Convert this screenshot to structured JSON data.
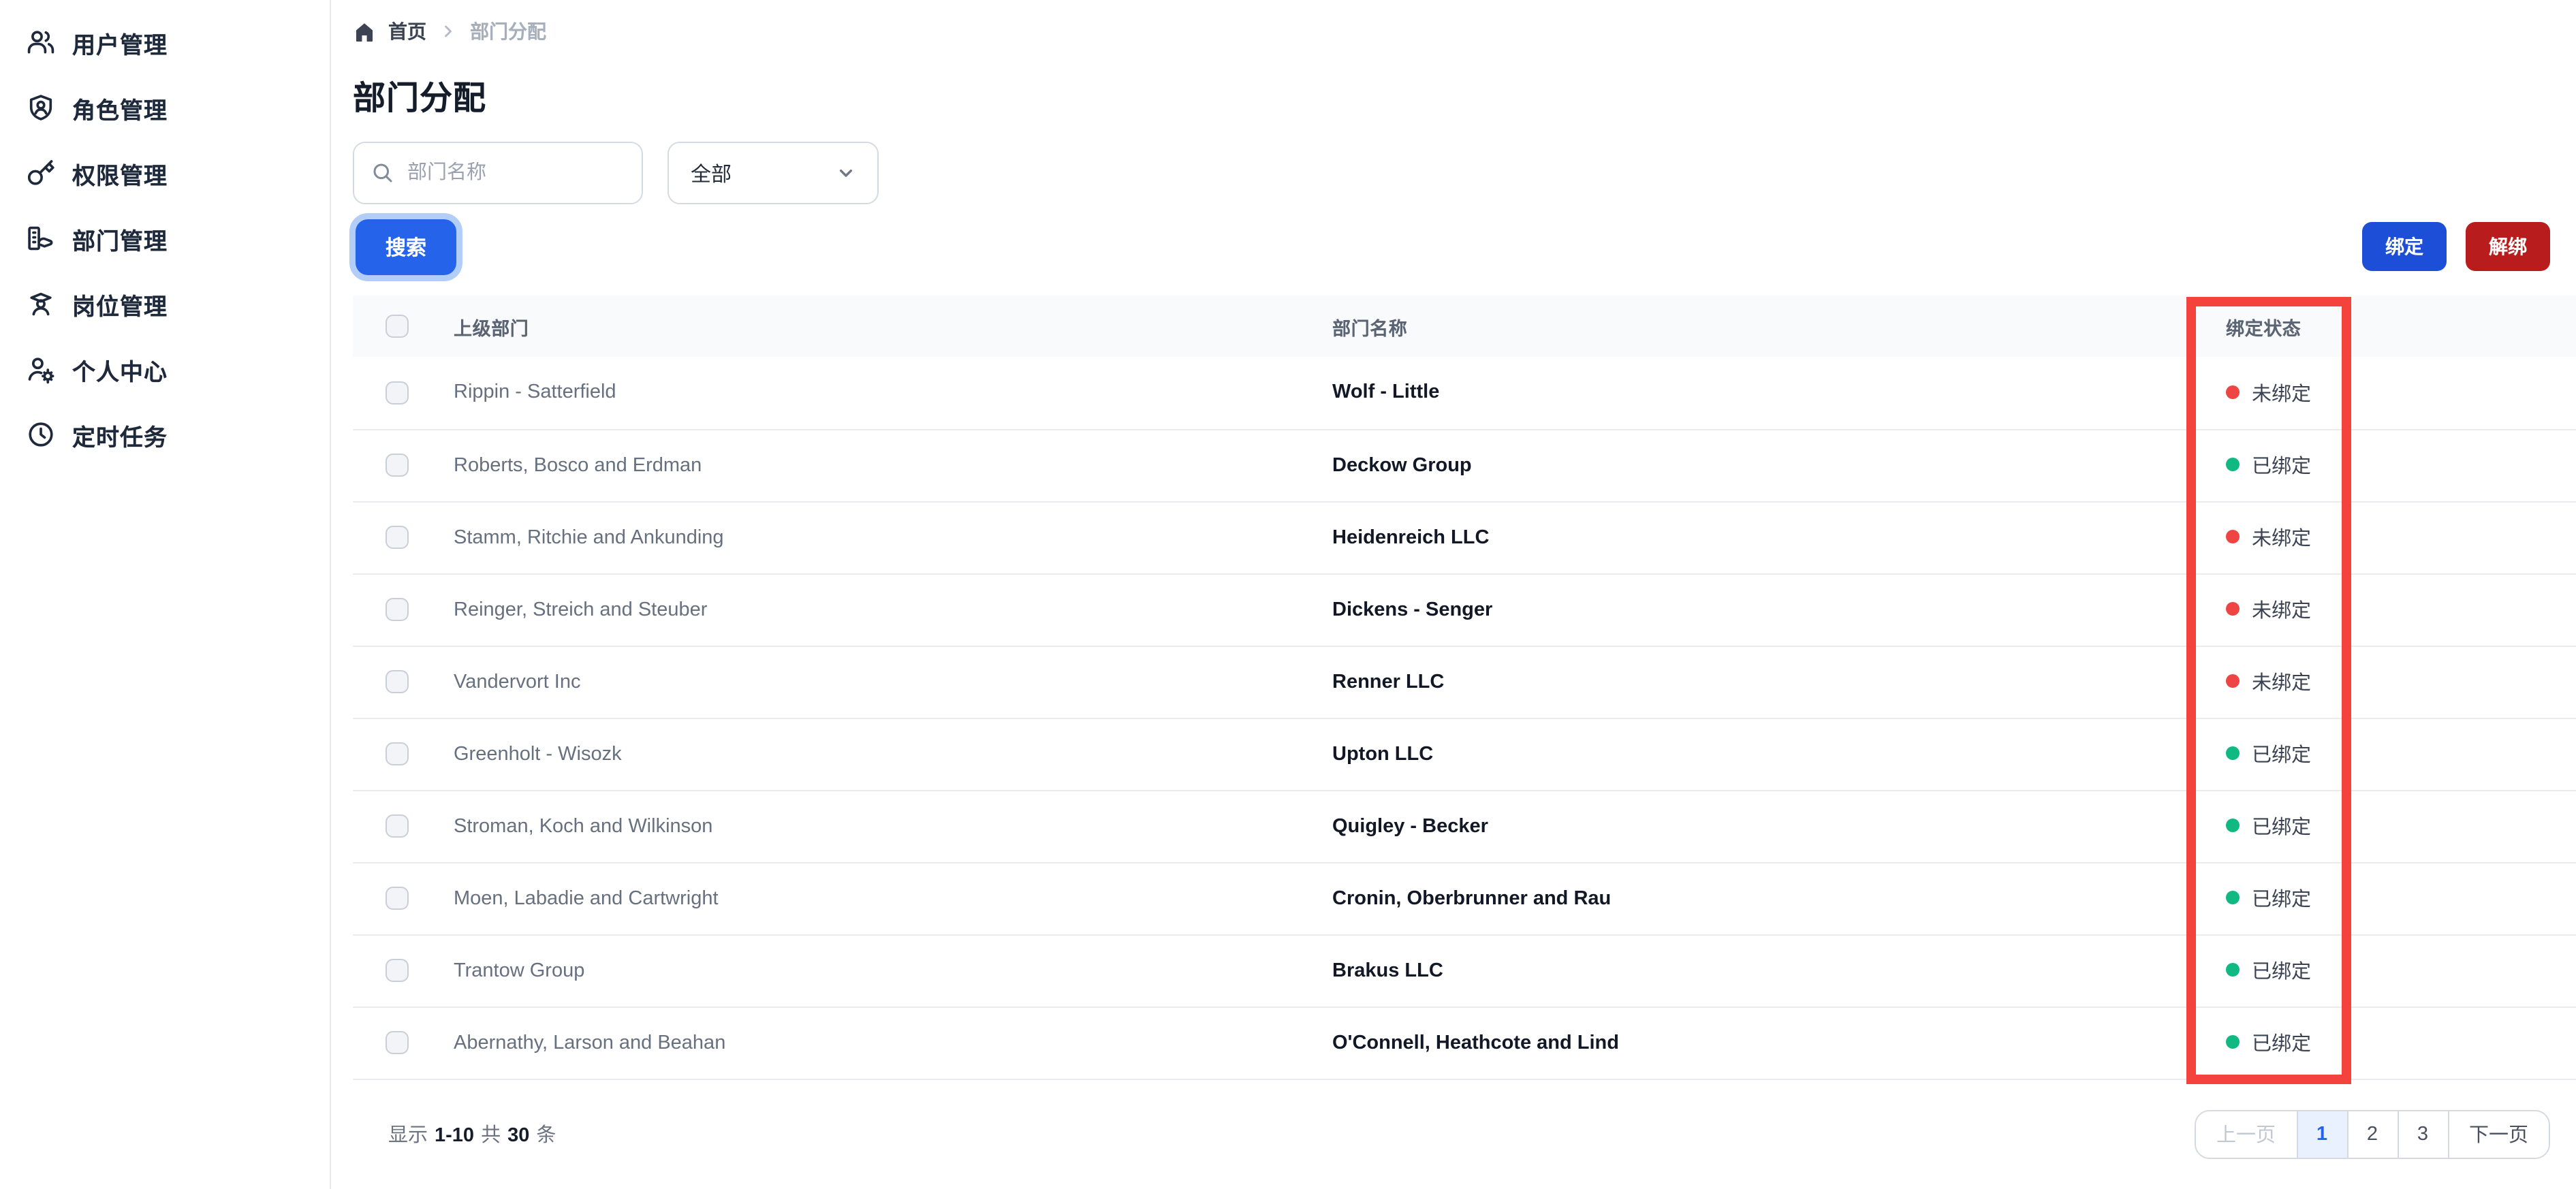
{
  "sidebar": {
    "items": [
      {
        "label": "用户管理",
        "icon": "users-icon"
      },
      {
        "label": "角色管理",
        "icon": "shield-user-icon"
      },
      {
        "label": "权限管理",
        "icon": "key-icon"
      },
      {
        "label": "部门管理",
        "icon": "organization-icon"
      },
      {
        "label": "岗位管理",
        "icon": "graduate-icon"
      },
      {
        "label": "个人中心",
        "icon": "user-gear-icon"
      },
      {
        "label": "定时任务",
        "icon": "clock-icon"
      }
    ]
  },
  "breadcrumb": {
    "home": "首页",
    "current": "部门分配"
  },
  "page": {
    "title": "部门分配"
  },
  "filters": {
    "search_placeholder": "部门名称",
    "select_value": "全部",
    "search_button": "搜索"
  },
  "actions": {
    "bind": "绑定",
    "unbind": "解绑"
  },
  "table": {
    "headers": {
      "parent": "上级部门",
      "name": "部门名称",
      "status": "绑定状态"
    },
    "status_labels": {
      "bound": "已绑定",
      "unbound": "未绑定"
    },
    "rows": [
      {
        "parent": "Rippin - Satterfield",
        "name": "Wolf - Little",
        "status": "unbound"
      },
      {
        "parent": "Roberts, Bosco and Erdman",
        "name": "Deckow Group",
        "status": "bound"
      },
      {
        "parent": "Stamm, Ritchie and Ankunding",
        "name": "Heidenreich LLC",
        "status": "unbound"
      },
      {
        "parent": "Reinger, Streich and Steuber",
        "name": "Dickens - Senger",
        "status": "unbound"
      },
      {
        "parent": "Vandervort Inc",
        "name": "Renner LLC",
        "status": "unbound"
      },
      {
        "parent": "Greenholt - Wisozk",
        "name": "Upton LLC",
        "status": "bound"
      },
      {
        "parent": "Stroman, Koch and Wilkinson",
        "name": "Quigley - Becker",
        "status": "bound"
      },
      {
        "parent": "Moen, Labadie and Cartwright",
        "name": "Cronin, Oberbrunner and Rau",
        "status": "bound"
      },
      {
        "parent": "Trantow Group",
        "name": "Brakus LLC",
        "status": "bound"
      },
      {
        "parent": "Abernathy, Larson and Beahan",
        "name": "O'Connell, Heathcote and Lind",
        "status": "bound"
      }
    ]
  },
  "pagination": {
    "show_label": "显示",
    "range": "1-10",
    "total_label": "共",
    "total": "30",
    "unit_label": "条",
    "prev": "上一页",
    "pages": [
      "1",
      "2",
      "3"
    ],
    "active_page": "1",
    "next": "下一页"
  },
  "colors": {
    "primary_blue": "#2563eb",
    "bind_blue": "#1d4ed8",
    "unbind_red": "#b91c1c",
    "bound_green": "#10b981",
    "unbound_red": "#ef4444",
    "highlight_red": "#f4433c"
  }
}
